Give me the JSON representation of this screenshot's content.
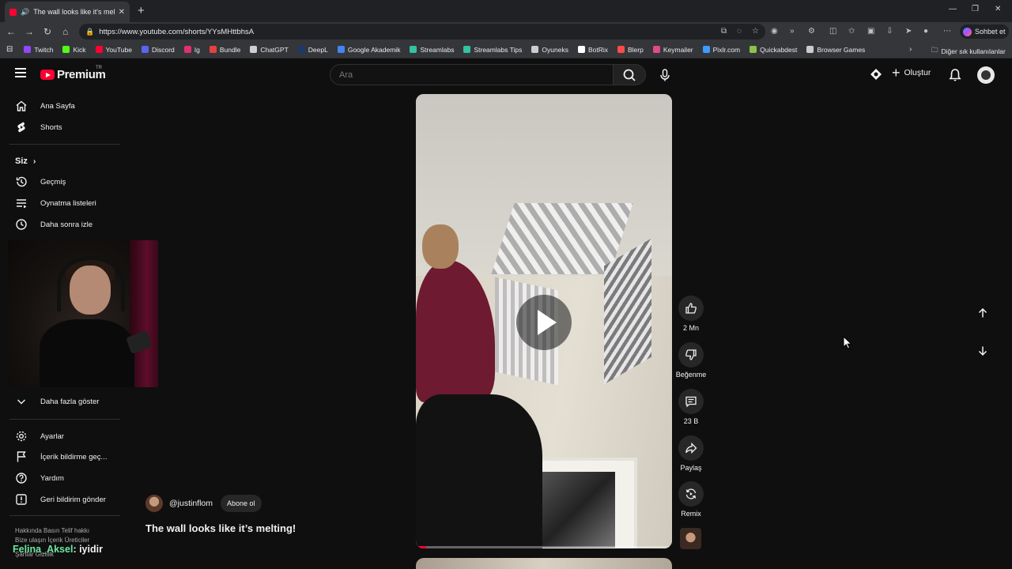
{
  "browser": {
    "tab_title": "The wall looks like it's melting",
    "url": "https://www.youtube.com/shorts/YYsMHttbhsA",
    "copilot_label": "Sohbet et",
    "bookmarks": [
      {
        "label": "Twitch",
        "color": "#9146ff"
      },
      {
        "label": "Kick",
        "color": "#53fc18"
      },
      {
        "label": "YouTube",
        "color": "#ff0033"
      },
      {
        "label": "Discord",
        "color": "#5865f2"
      },
      {
        "label": "Ig",
        "color": "#e1306c"
      },
      {
        "label": "Bundle",
        "color": "#e64040"
      },
      {
        "label": "ChatGPT",
        "color": "#cfcfcf"
      },
      {
        "label": "DeepL",
        "color": "#1b3a6a"
      },
      {
        "label": "Google Akademik",
        "color": "#4285f4"
      },
      {
        "label": "Streamlabs",
        "color": "#31c3a2"
      },
      {
        "label": "Streamlabs Tips",
        "color": "#31c3a2"
      },
      {
        "label": "Oyuneks",
        "color": "#cccccc"
      },
      {
        "label": "BotRix",
        "color": "#ffffff"
      },
      {
        "label": "Blerp",
        "color": "#ff4b4b"
      },
      {
        "label": "Keymailer",
        "color": "#e24a8b"
      },
      {
        "label": "Pixlr.com",
        "color": "#3b9cff"
      },
      {
        "label": "Quickabdest",
        "color": "#8bc34a"
      },
      {
        "label": "Browser Games",
        "color": "#cccccc"
      }
    ],
    "other_bookmarks": "Diğer sık kullanılanlar"
  },
  "header": {
    "logo_text": "Premium",
    "logo_sup": "TR",
    "search_placeholder": "Ara",
    "create_label": "Oluştur"
  },
  "sidebar": {
    "main": [
      {
        "label": "Ana Sayfa",
        "icon": "home-icon"
      },
      {
        "label": "Shorts",
        "icon": "shorts-icon"
      }
    ],
    "you_title": "Siz",
    "you": [
      {
        "label": "Geçmiş",
        "icon": "history-icon"
      },
      {
        "label": "Oynatma listeleri",
        "icon": "playlist-icon"
      },
      {
        "label": "Daha sonra izle",
        "icon": "clock-icon"
      }
    ],
    "show_more": "Daha fazla göster",
    "more": [
      {
        "label": "Ayarlar",
        "icon": "gear-icon"
      },
      {
        "label": "İçerik bildirme geç...",
        "icon": "flag-icon"
      },
      {
        "label": "Yardım",
        "icon": "help-icon"
      },
      {
        "label": "Geri bildirim gönder",
        "icon": "feedback-icon"
      }
    ],
    "footer_line1": "Hakkında   Basın   Telif hakkı",
    "footer_line2": "Bize ulaşın   İçerik Üreticiler",
    "footer_line3": "Şartlar   Gizlilik"
  },
  "overlay": {
    "chat_name": "Felina_Aksel",
    "chat_message": ": iyidir"
  },
  "short": {
    "channel": "@justinflom",
    "subscribe_label": "Abone ol",
    "title": "The wall looks like it’s melting!",
    "progress": 0.04,
    "actions": {
      "likes": "2 Mn",
      "dislike_label": "Beğenme",
      "comments": "23 B",
      "share_label": "Paylaş",
      "remix_label": "Remix"
    }
  },
  "colors": {
    "accent": "#ff0033",
    "background": "#0f0f0f"
  }
}
